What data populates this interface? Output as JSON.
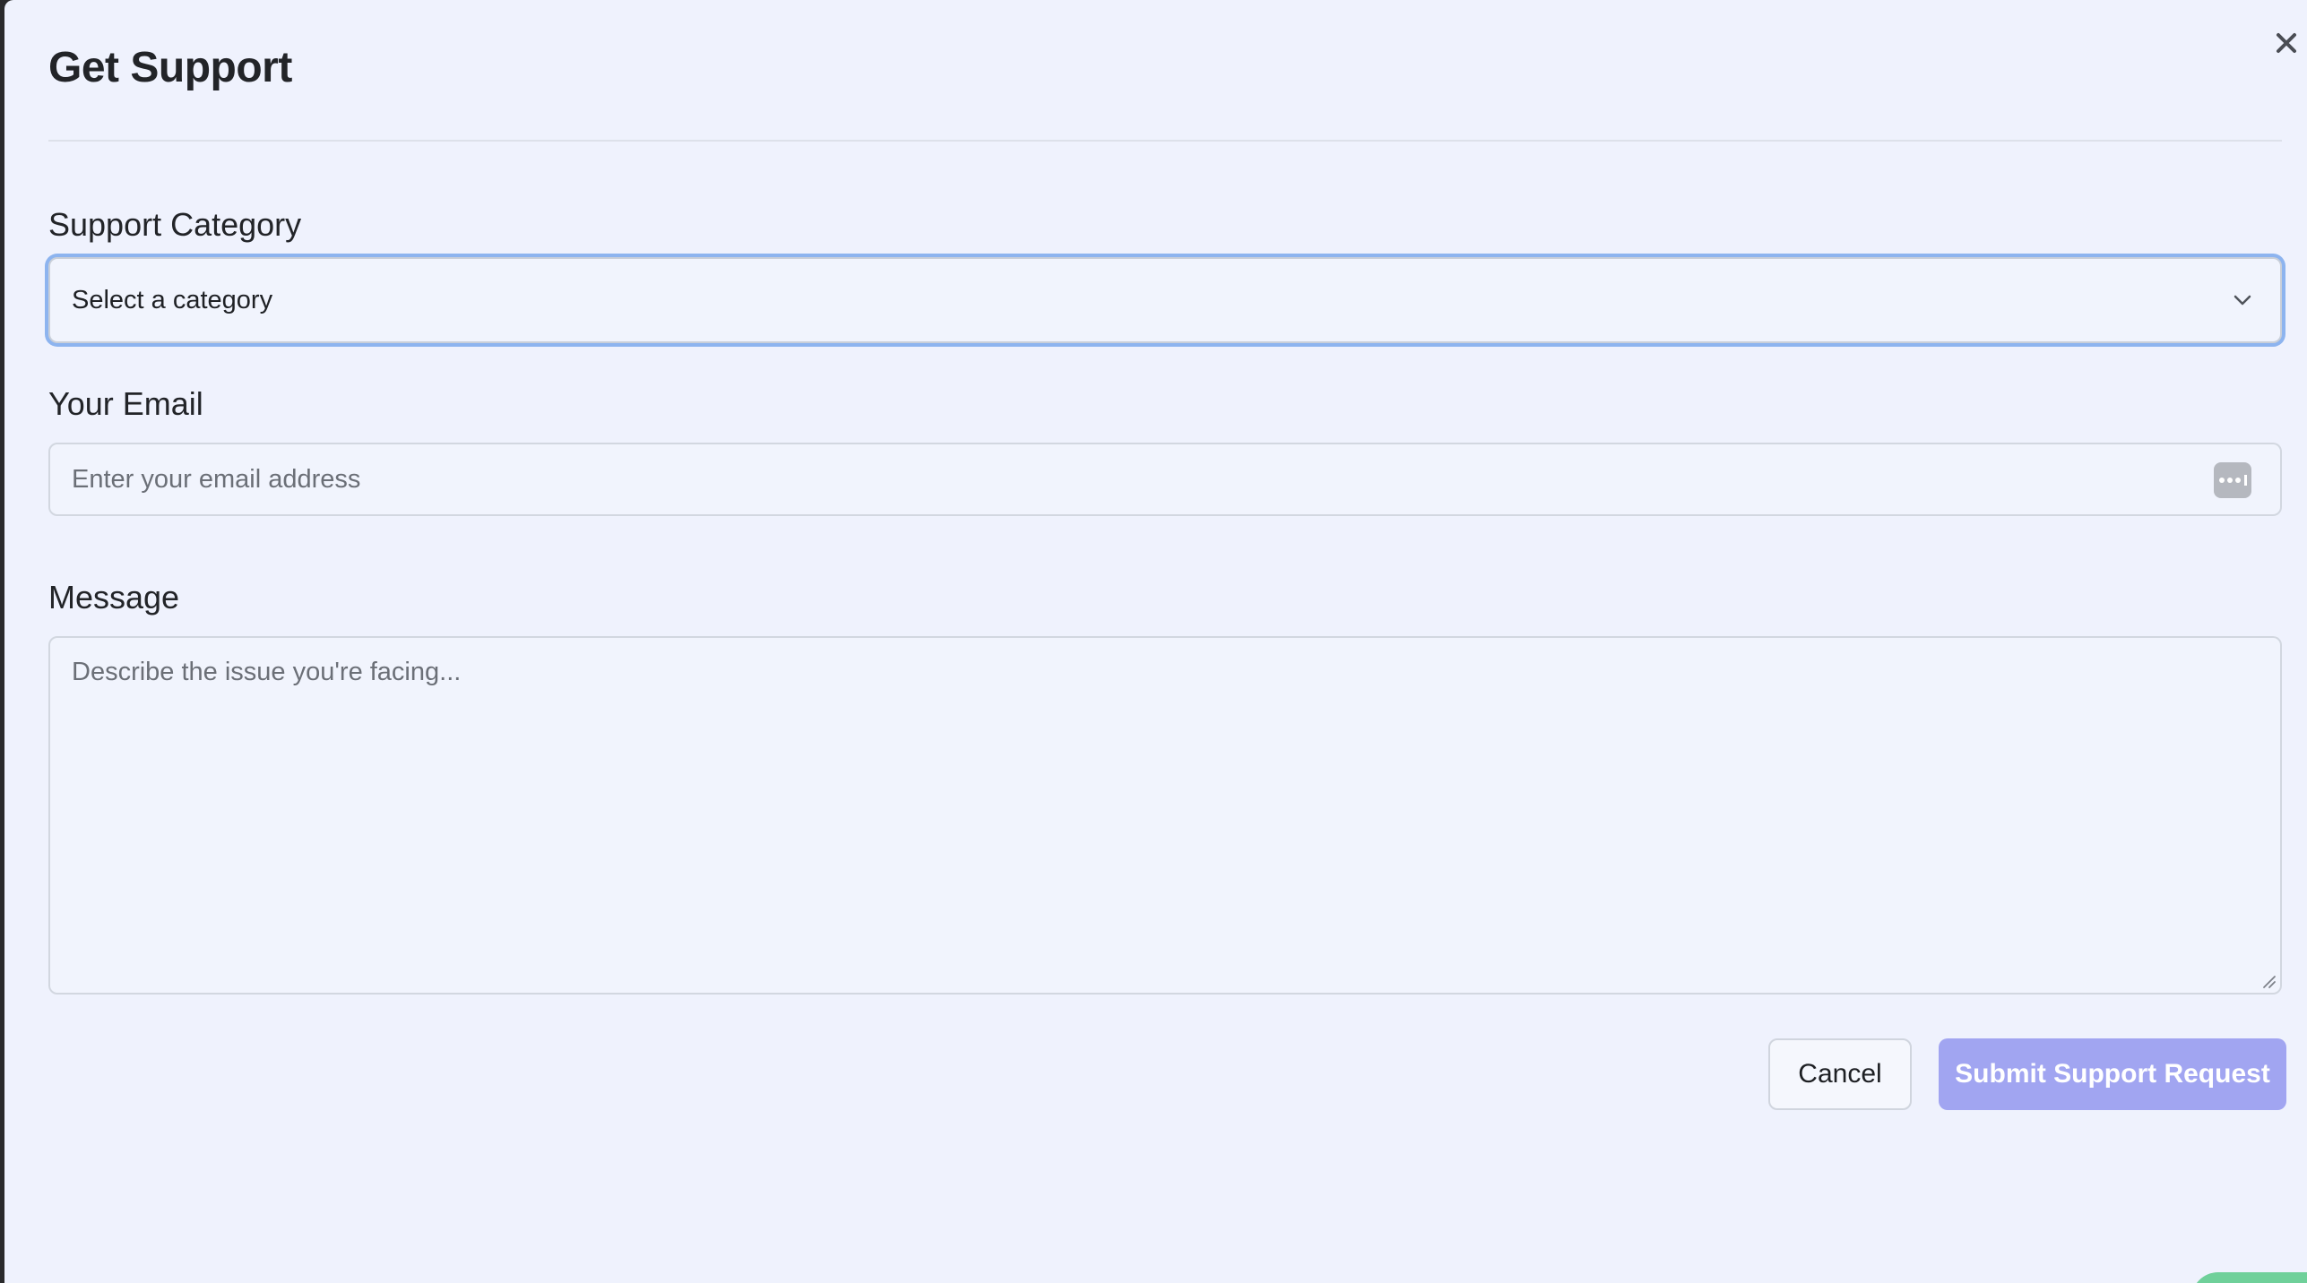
{
  "dialog": {
    "title": "Get Support",
    "close_icon": "close-icon"
  },
  "fields": {
    "category": {
      "label": "Support Category",
      "selected": "Select a category",
      "icon": "chevron-down-icon"
    },
    "email": {
      "label": "Your Email",
      "value": "",
      "placeholder": "Enter your email address",
      "icon": "password-manager-icon"
    },
    "message": {
      "label": "Message",
      "value": "",
      "placeholder": "Describe the issue you're facing..."
    }
  },
  "actions": {
    "cancel_label": "Cancel",
    "submit_label": "Submit Support Request"
  },
  "colors": {
    "background": "#eff2fd",
    "focus_ring": "#8db4ef",
    "submit": "#a1a5f1",
    "corner_accent": "#6fd09a"
  }
}
